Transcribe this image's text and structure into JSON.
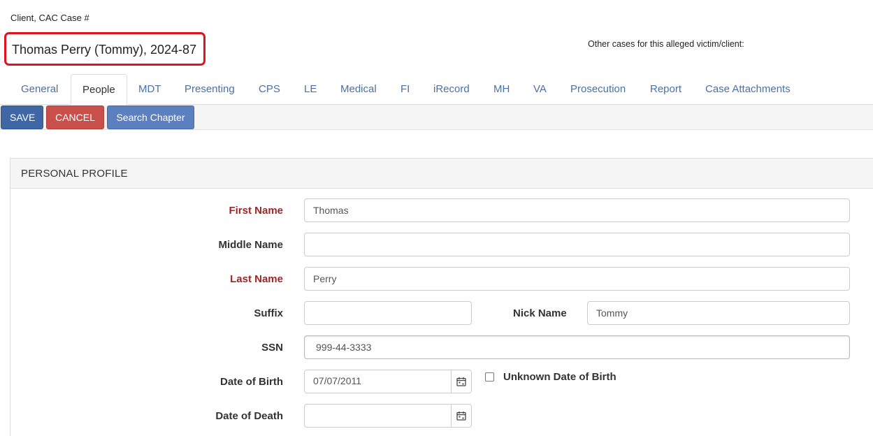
{
  "case_header": {
    "label": "Client, CAC Case #",
    "title": "Thomas Perry (Tommy), 2024-87",
    "other_cases_label": "Other cases for this alleged victim/client:"
  },
  "tabs": [
    {
      "label": "General"
    },
    {
      "label": "People",
      "active": true
    },
    {
      "label": "MDT"
    },
    {
      "label": "Presenting"
    },
    {
      "label": "CPS"
    },
    {
      "label": "LE"
    },
    {
      "label": "Medical"
    },
    {
      "label": "FI"
    },
    {
      "label": "iRecord"
    },
    {
      "label": "MH"
    },
    {
      "label": "VA"
    },
    {
      "label": "Prosecution"
    },
    {
      "label": "Report"
    },
    {
      "label": "Case Attachments"
    }
  ],
  "toolbar": {
    "save_label": "SAVE",
    "cancel_label": "CANCEL",
    "search_label": "Search Chapter"
  },
  "profile": {
    "heading": "PERSONAL PROFILE",
    "first_name": {
      "label": "First Name",
      "value": "Thomas"
    },
    "middle_name": {
      "label": "Middle Name",
      "value": ""
    },
    "last_name": {
      "label": "Last Name",
      "value": "Perry"
    },
    "suffix": {
      "label": "Suffix",
      "value": ""
    },
    "nick_name": {
      "label": "Nick Name",
      "value": "Tommy"
    },
    "ssn": {
      "label": "SSN",
      "value": "999-44-3333"
    },
    "dob": {
      "label": "Date of Birth",
      "value": "07/07/2011"
    },
    "unknown_dob": {
      "label": "Unknown Date of Birth",
      "checked": false
    },
    "dod": {
      "label": "Date of Death",
      "value": ""
    }
  },
  "colors": {
    "tab_link": "#4a70a8",
    "required_label": "#a02626",
    "save": "#3f67a6",
    "cancel": "#c9504a",
    "search": "#5b7fbf",
    "highlight_box": "#e0141e"
  },
  "icons": {
    "calendar": "calendar-icon"
  }
}
